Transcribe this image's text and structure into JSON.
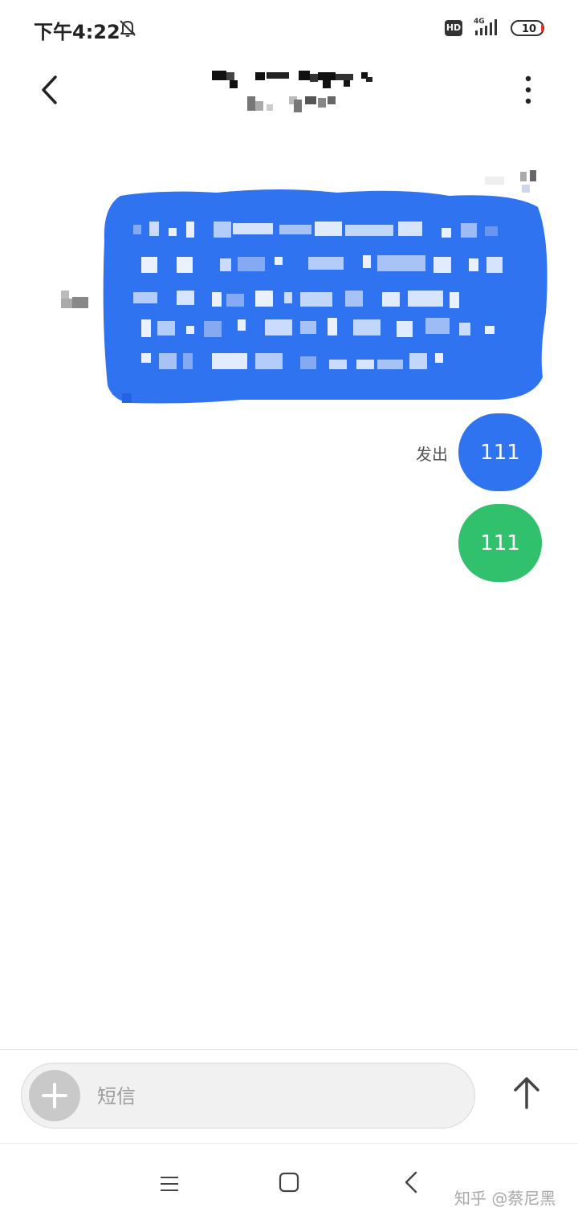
{
  "status_bar": {
    "time": "下午4:22",
    "hd_badge": "HD",
    "network": "4G",
    "battery": "10"
  },
  "header": {
    "back_icon": "chevron-left-icon",
    "more_icon": "more-vertical-icon"
  },
  "messages": [
    {
      "text": "111",
      "status": "发出",
      "color": "#2f73f0"
    },
    {
      "text": "111",
      "status": "",
      "color": "#31c06c"
    }
  ],
  "composer": {
    "placeholder": "短信",
    "add_icon": "plus-icon",
    "send_icon": "arrow-up-icon"
  },
  "nav": {
    "menu_icon": "menu-icon",
    "home_icon": "square-icon",
    "back_icon": "triangle-back-icon"
  },
  "watermark": "知乎 @蔡尼黑",
  "colors": {
    "sent_bubble": "#2f73f0",
    "delivered_bubble": "#31c06c",
    "incoming_bubble": "#2f73f0"
  }
}
